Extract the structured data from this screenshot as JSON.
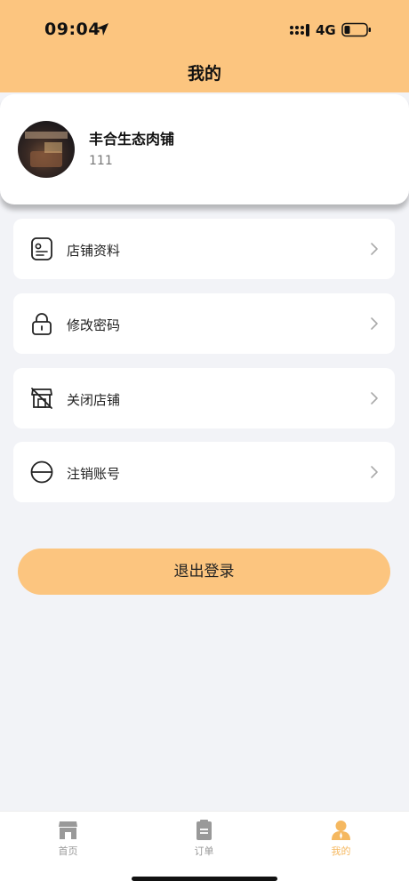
{
  "status_bar": {
    "time": "09:04",
    "network": "4G"
  },
  "header": {
    "title": "我的"
  },
  "profile": {
    "name": "丰合生态肉铺",
    "subtitle": "111"
  },
  "menu": {
    "items": [
      {
        "label": "店铺资料",
        "icon": "store-info-icon"
      },
      {
        "label": "修改密码",
        "icon": "lock-icon"
      },
      {
        "label": "关闭店铺",
        "icon": "close-store-icon"
      },
      {
        "label": "注销账号",
        "icon": "deactivate-icon"
      }
    ]
  },
  "logout": {
    "label": "退出登录"
  },
  "tabs": {
    "items": [
      {
        "label": "首页",
        "icon": "store-icon"
      },
      {
        "label": "订单",
        "icon": "clipboard-icon"
      },
      {
        "label": "我的",
        "icon": "person-icon",
        "active": true
      }
    ]
  },
  "colors": {
    "accent": "#fcc57f",
    "active_tab": "#f5b860",
    "background": "#f2f3f7"
  }
}
